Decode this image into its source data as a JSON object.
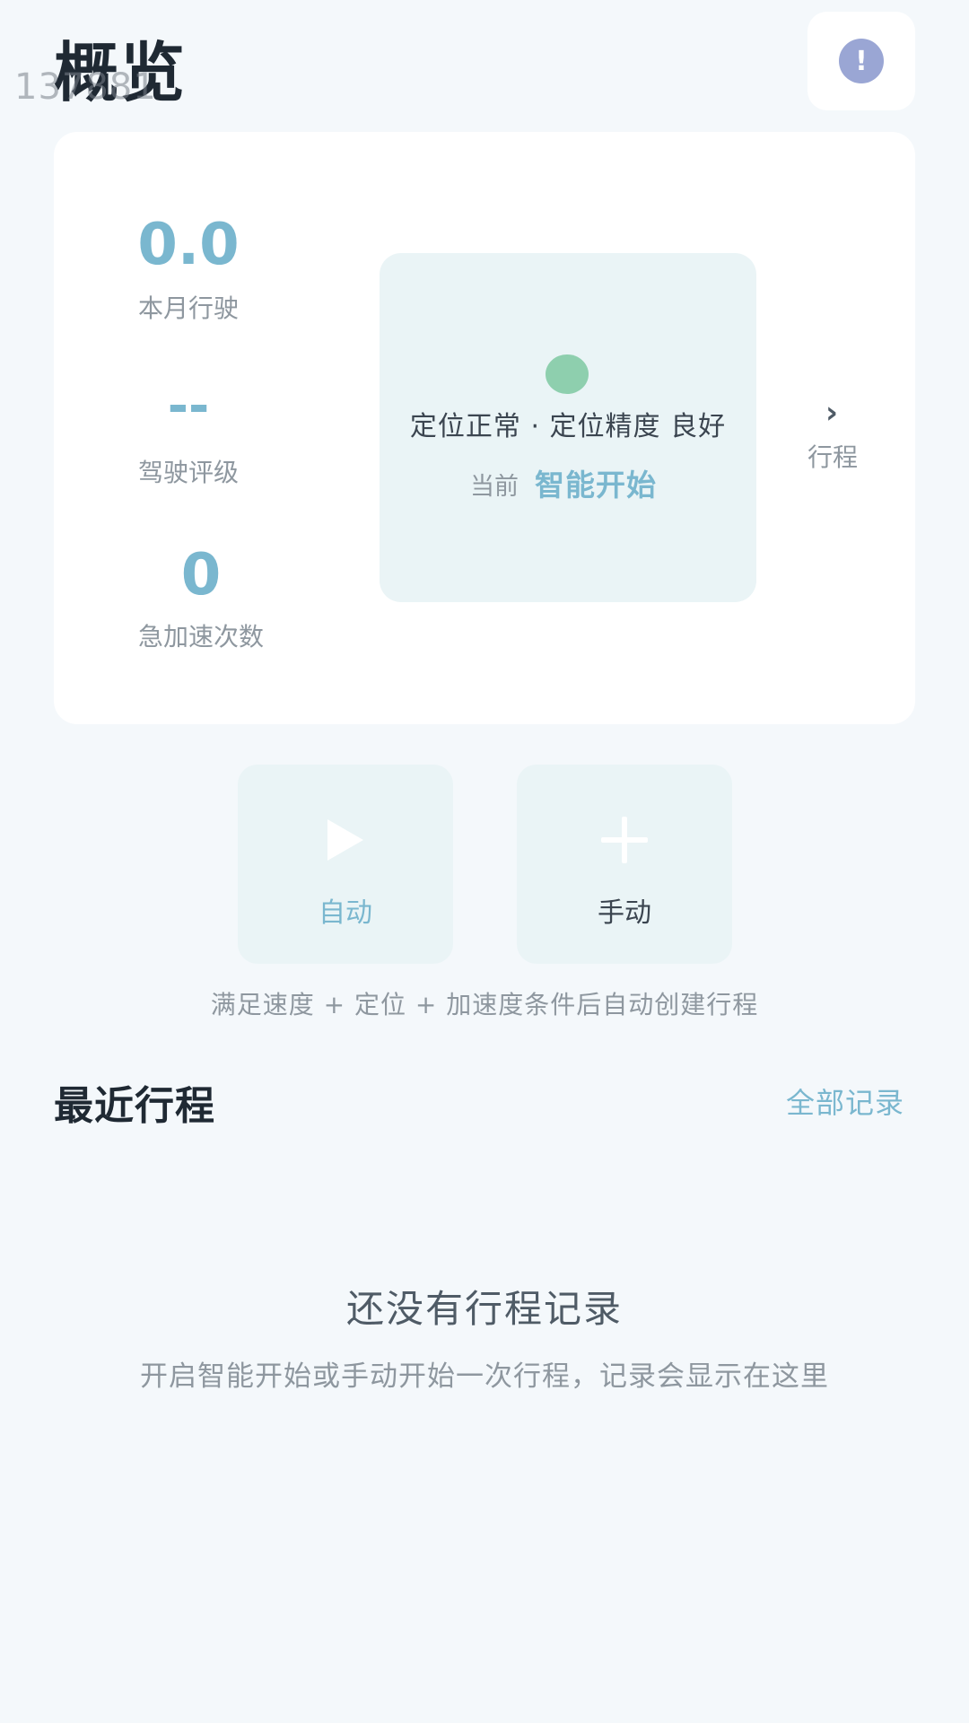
{
  "header": {
    "title": "概览",
    "overlay_number": "137881"
  },
  "stats": {
    "monthly_distance": {
      "value": "0.0",
      "label": "本月行驶"
    },
    "driving_rating": {
      "value": "--",
      "label": "驾驶评级"
    },
    "hard_accel": {
      "value": "0",
      "label": "急加速次数"
    }
  },
  "status": {
    "location_text": "定位正常 · 定位精度 良好",
    "current_label": "当前",
    "current_mode": "智能开始",
    "dot_color": "#8ecfae"
  },
  "trip_link": {
    "label": "行程"
  },
  "modes": {
    "auto": {
      "label": "自动",
      "icon": "play-icon"
    },
    "manual": {
      "label": "手动",
      "icon": "plus-icon"
    },
    "hint": "满足速度 + 定位 + 加速度条件后自动创建行程"
  },
  "recent": {
    "title": "最近行程",
    "all_records": "全部记录",
    "empty_title": "还没有行程记录",
    "empty_desc": "开启智能开始或手动开始一次行程，记录会显示在这里"
  },
  "colors": {
    "accent": "#7ab7cf",
    "background": "#f4f8fb",
    "panel": "#eaf4f6",
    "alert_icon": "#9aa6d4"
  }
}
